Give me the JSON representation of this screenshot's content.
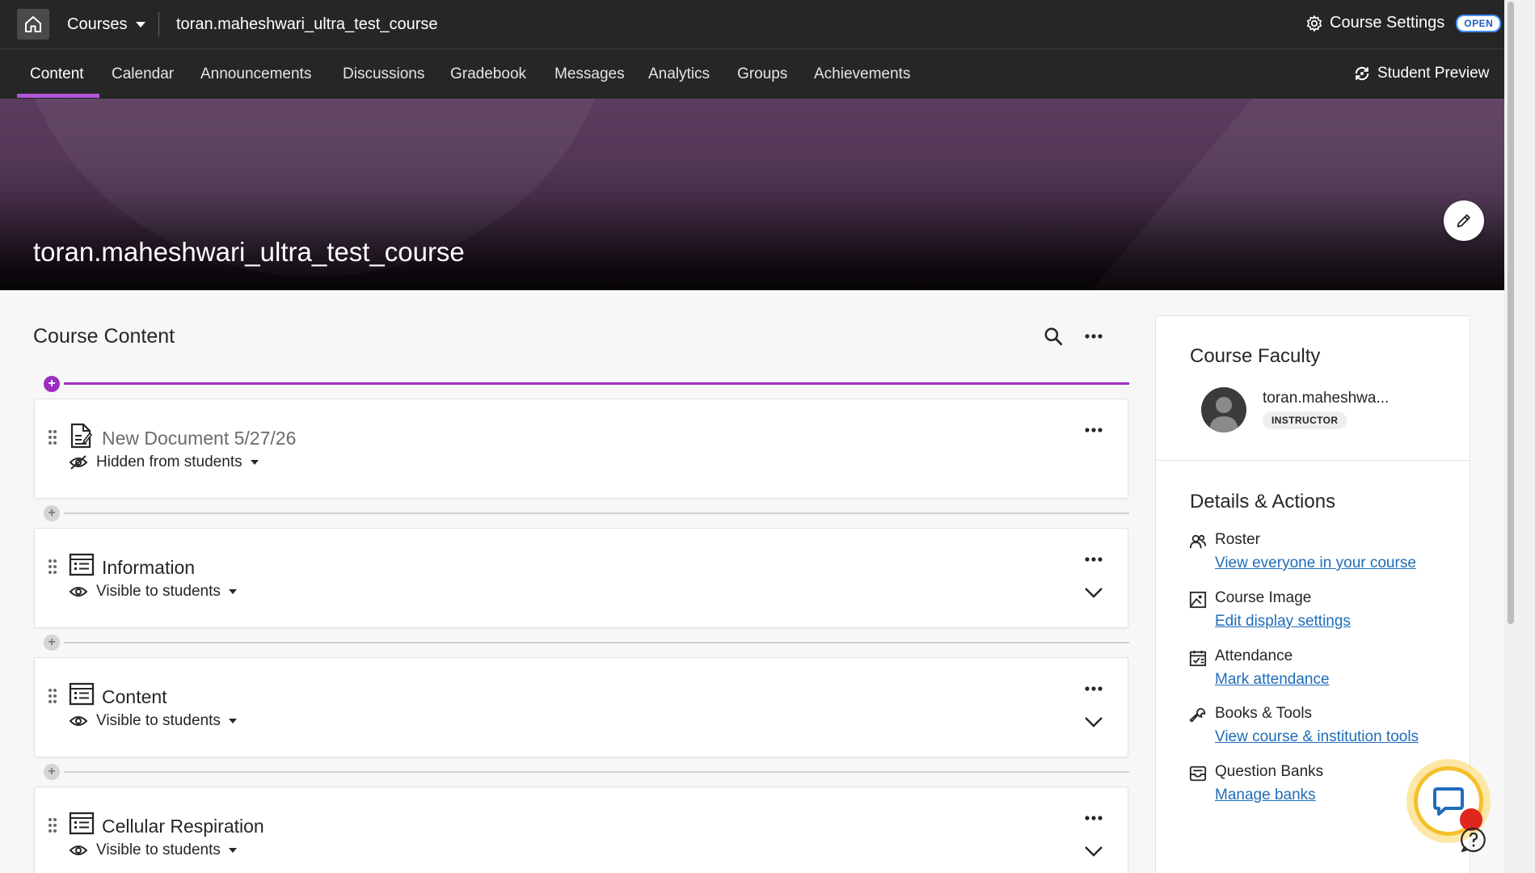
{
  "topbar": {
    "courses_label": "Courses",
    "course_name": "toran.maheshwari_ultra_test_course",
    "settings_label": "Course Settings",
    "settings_badge": "OPEN"
  },
  "nav": {
    "tabs": [
      "Content",
      "Calendar",
      "Announcements",
      "Discussions",
      "Gradebook",
      "Messages",
      "Analytics",
      "Groups",
      "Achievements"
    ],
    "active_tab": "Content",
    "student_preview": "Student Preview"
  },
  "banner": {
    "title": "toran.maheshwari_ultra_test_course"
  },
  "content": {
    "heading": "Course Content",
    "items": [
      {
        "title": "New Document 5/27/26",
        "visibility": "Hidden from students",
        "icon": "document-icon",
        "hidden": true
      },
      {
        "title": "Information",
        "visibility": "Visible to students",
        "icon": "folder-icon",
        "hidden": false
      },
      {
        "title": "Content",
        "visibility": "Visible to students",
        "icon": "folder-icon",
        "hidden": false
      },
      {
        "title": "Cellular Respiration",
        "visibility": "Visible to students",
        "icon": "folder-icon",
        "hidden": false
      }
    ]
  },
  "sidebar": {
    "faculty_heading": "Course Faculty",
    "faculty_name": "toran.maheshwa...",
    "faculty_role": "INSTRUCTOR",
    "details_heading": "Details & Actions",
    "actions": [
      {
        "label": "Roster",
        "link": "View everyone in your course",
        "icon": "roster-icon"
      },
      {
        "label": "Course Image",
        "link": "Edit display settings",
        "icon": "image-icon"
      },
      {
        "label": "Attendance",
        "link": "Mark attendance",
        "icon": "attendance-icon"
      },
      {
        "label": "Books & Tools",
        "link": "View course & institution tools",
        "icon": "wrench-icon"
      },
      {
        "label": "Question Banks",
        "link": "Manage banks",
        "icon": "question-bank-icon"
      }
    ]
  },
  "colors": {
    "accent": "#a032c4",
    "link": "#1f6dba",
    "topbar": "#262626",
    "open_badge": "#3f8cff",
    "chat_ring": "#f5c02c",
    "notification_dot": "#e0261d"
  }
}
